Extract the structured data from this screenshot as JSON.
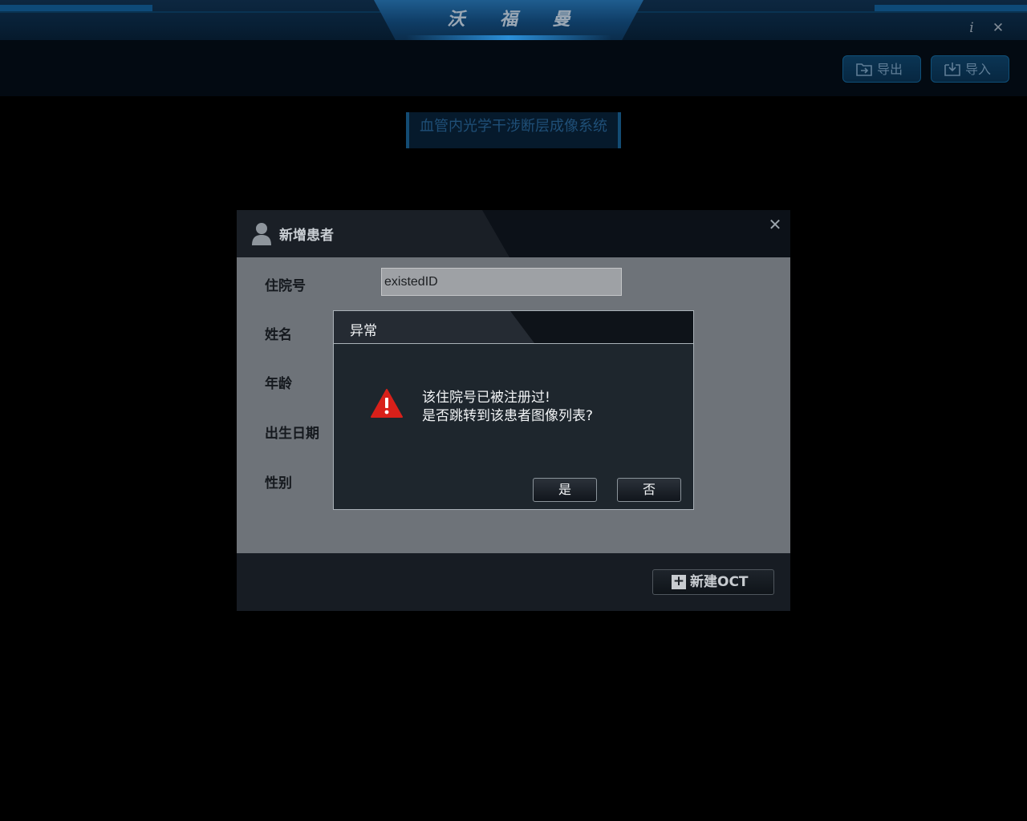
{
  "app": {
    "title": "沃 福 曼",
    "info_icon": "info-icon",
    "close_icon": "close-icon"
  },
  "toolbar": {
    "export_label": "导出",
    "import_label": "导入",
    "export_icon": "folder-export-icon",
    "import_icon": "import-icon"
  },
  "subtitle": "血管内光学干涉断层成像系统",
  "patient_dialog": {
    "title": "新增患者",
    "icon": "user-icon",
    "fields": {
      "hospital_id_label": "住院号",
      "hospital_id_value": "existedID",
      "name_label": "姓名",
      "age_label": "年龄",
      "birth_date_label": "出生日期",
      "sex_label": "性别"
    },
    "new_oct_label": "新建OCT"
  },
  "error_dialog": {
    "title": "异常",
    "icon": "warning-icon",
    "message_line1": "该住院号已被注册过!",
    "message_line2": "是否跳转到该患者图像列表?",
    "yes_label": "是",
    "no_label": "否"
  },
  "colors": {
    "title_bar": "#0f3d66",
    "accent_blue": "#0f4f78",
    "dialog_body": "#6e7379",
    "error_dialog_body": "#1e262d",
    "warning_red": "#d8201a"
  }
}
